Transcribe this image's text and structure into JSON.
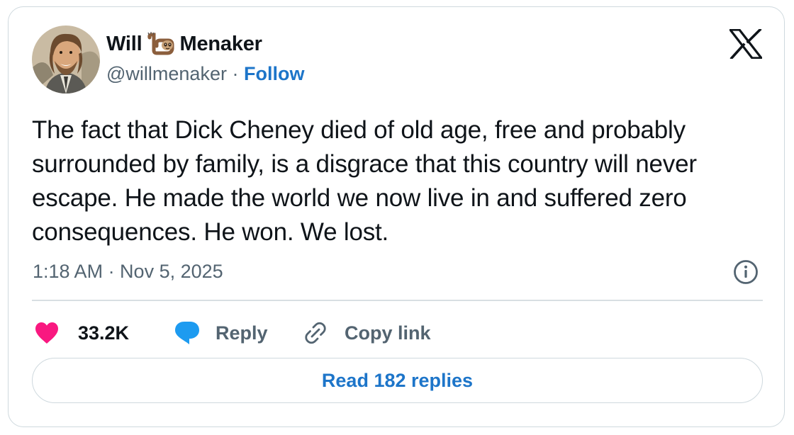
{
  "author": {
    "name_first": "Will",
    "name_emoji": "sloth-emoji",
    "name_last": "Menaker",
    "handle": "@willmenaker",
    "separator": "·",
    "follow_label": "Follow",
    "avatar": "illustrated-portrait-avatar"
  },
  "brand": {
    "logo": "x-logo-icon"
  },
  "tweet": {
    "text": "The fact that Dick Cheney died of old age, free and probably surrounded by family, is a disgrace that this country will never escape. He made the world we now live in and suffered zero consequences. He won. We lost.",
    "timestamp": "1:18 AM · Nov 5, 2025"
  },
  "actions": {
    "like_count": "33.2K",
    "reply_label": "Reply",
    "copy_link_label": "Copy link"
  },
  "footer": {
    "read_replies_label": "Read 182 replies"
  },
  "colors": {
    "accent_blue": "#1d75c9",
    "heart_pink": "#f91880",
    "reply_bubble_blue": "#1d9bf0",
    "secondary_text": "#536471",
    "border": "#cfd9de"
  }
}
